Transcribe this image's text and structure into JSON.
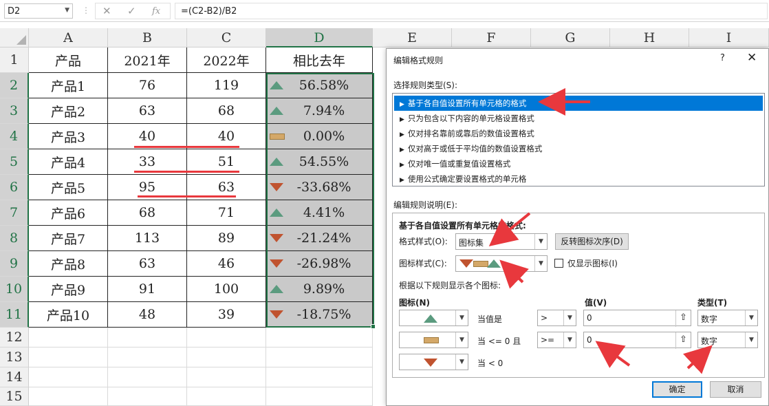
{
  "formula_bar": {
    "name_box": "D2",
    "formula": "=(C2-B2)/B2",
    "cancel_icon": "✕",
    "enter_icon": "✓",
    "fx_icon": "fx"
  },
  "columns": [
    "A",
    "B",
    "C",
    "D",
    "E",
    "F",
    "G",
    "H",
    "I"
  ],
  "rows": [
    "1",
    "2",
    "3",
    "4",
    "5",
    "6",
    "7",
    "8",
    "9",
    "10",
    "11",
    "12",
    "13",
    "14",
    "15"
  ],
  "table": {
    "headers": [
      "产品",
      "2021年",
      "2022年",
      "相比去年"
    ],
    "rows": [
      {
        "product": "产品1",
        "y2021": "76",
        "y2022": "119",
        "change": "56.58%",
        "icon": "up"
      },
      {
        "product": "产品2",
        "y2021": "63",
        "y2022": "68",
        "change": "7.94%",
        "icon": "up"
      },
      {
        "product": "产品3",
        "y2021": "40",
        "y2022": "40",
        "change": "0.00%",
        "icon": "mid"
      },
      {
        "product": "产品4",
        "y2021": "33",
        "y2022": "51",
        "change": "54.55%",
        "icon": "up"
      },
      {
        "product": "产品5",
        "y2021": "95",
        "y2022": "63",
        "change": "-33.68%",
        "icon": "down"
      },
      {
        "product": "产品6",
        "y2021": "68",
        "y2022": "71",
        "change": "4.41%",
        "icon": "up"
      },
      {
        "product": "产品7",
        "y2021": "113",
        "y2022": "89",
        "change": "-21.24%",
        "icon": "down"
      },
      {
        "product": "产品8",
        "y2021": "63",
        "y2022": "46",
        "change": "-26.98%",
        "icon": "down"
      },
      {
        "product": "产品9",
        "y2021": "91",
        "y2022": "100",
        "change": "9.89%",
        "icon": "up"
      },
      {
        "product": "产品10",
        "y2021": "48",
        "y2022": "39",
        "change": "-18.75%",
        "icon": "down"
      }
    ]
  },
  "dialog": {
    "title": "编辑格式规则",
    "help": "?",
    "close": "✕",
    "select_type_label": "选择规则类型(S):",
    "rule_types": [
      "基于各自值设置所有单元格的格式",
      "只为包含以下内容的单元格设置格式",
      "仅对排名靠前或靠后的数值设置格式",
      "仅对高于或低于平均值的数值设置格式",
      "仅对唯一值或重复值设置格式",
      "使用公式确定要设置格式的单元格"
    ],
    "edit_desc_label": "编辑规则说明(E):",
    "desc_heading": "基于各自值设置所有单元格的格式:",
    "format_style_label": "格式样式(O):",
    "format_style_value": "图标集",
    "reverse_button": "反转图标次序(D)",
    "icon_style_label": "图标样式(C):",
    "show_icon_only": "仅显示图标(I)",
    "rule_caption": "根据以下规则显示各个图标:",
    "col_icon": "图标(N)",
    "col_value": "值(V)",
    "col_type": "类型(T)",
    "rules": [
      {
        "icon": "up",
        "cond": "当值是",
        "op": ">",
        "value": "0",
        "type": "数字"
      },
      {
        "icon": "mid",
        "cond": "当 <= 0 且",
        "op": ">=",
        "value": "0",
        "type": "数字"
      },
      {
        "icon": "down",
        "cond": "当 < 0"
      }
    ],
    "ok": "确定",
    "cancel": "取消"
  },
  "colors": {
    "accent_green": "#217346",
    "icon_up": "#5b9b7f",
    "icon_mid": "#d4a868",
    "icon_down": "#c0532f",
    "selection_blue": "#0078d7",
    "annotation_red": "#e8383d"
  }
}
